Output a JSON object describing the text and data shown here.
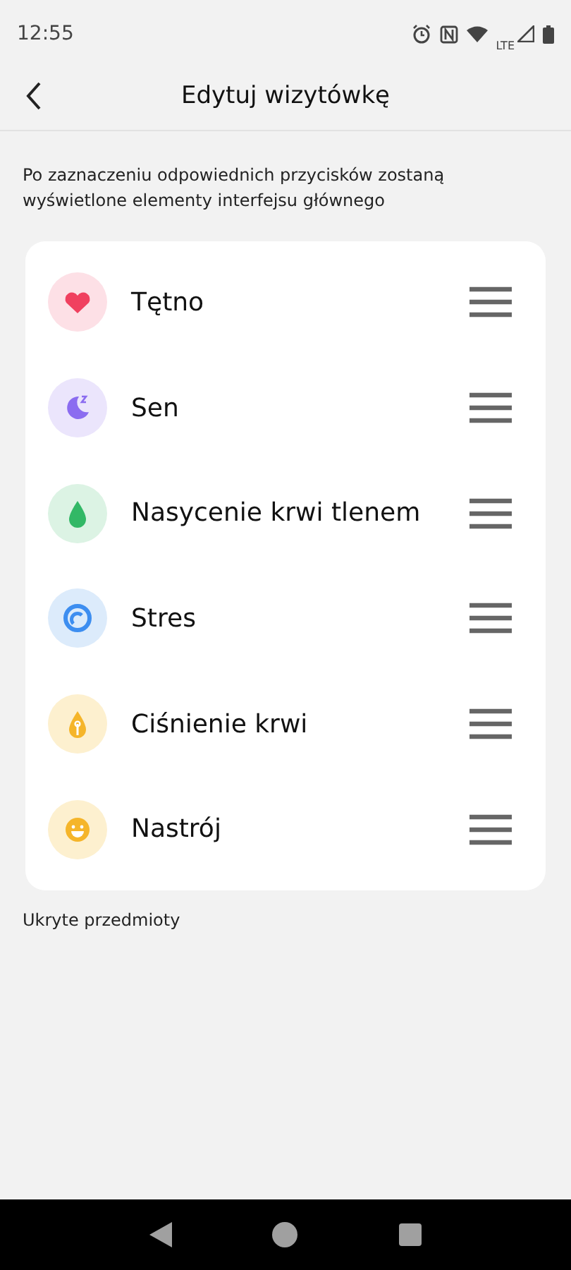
{
  "status_bar": {
    "time": "12:55",
    "network": "LTE"
  },
  "header": {
    "title": "Edytuj wizytówkę"
  },
  "description": "Po zaznaczeniu odpowiednich przycisków zostaną wyświetlone elementy interfejsu głównego",
  "items": [
    {
      "label": "Tętno",
      "kind": "heart"
    },
    {
      "label": "Sen",
      "kind": "sleep"
    },
    {
      "label": "Nasycenie krwi tlenem",
      "kind": "oxygen"
    },
    {
      "label": "Stres",
      "kind": "stress"
    },
    {
      "label": "Ciśnienie krwi",
      "kind": "pressure"
    },
    {
      "label": "Nastrój",
      "kind": "mood"
    }
  ],
  "hidden_section": {
    "title": "Ukryte przedmioty"
  }
}
